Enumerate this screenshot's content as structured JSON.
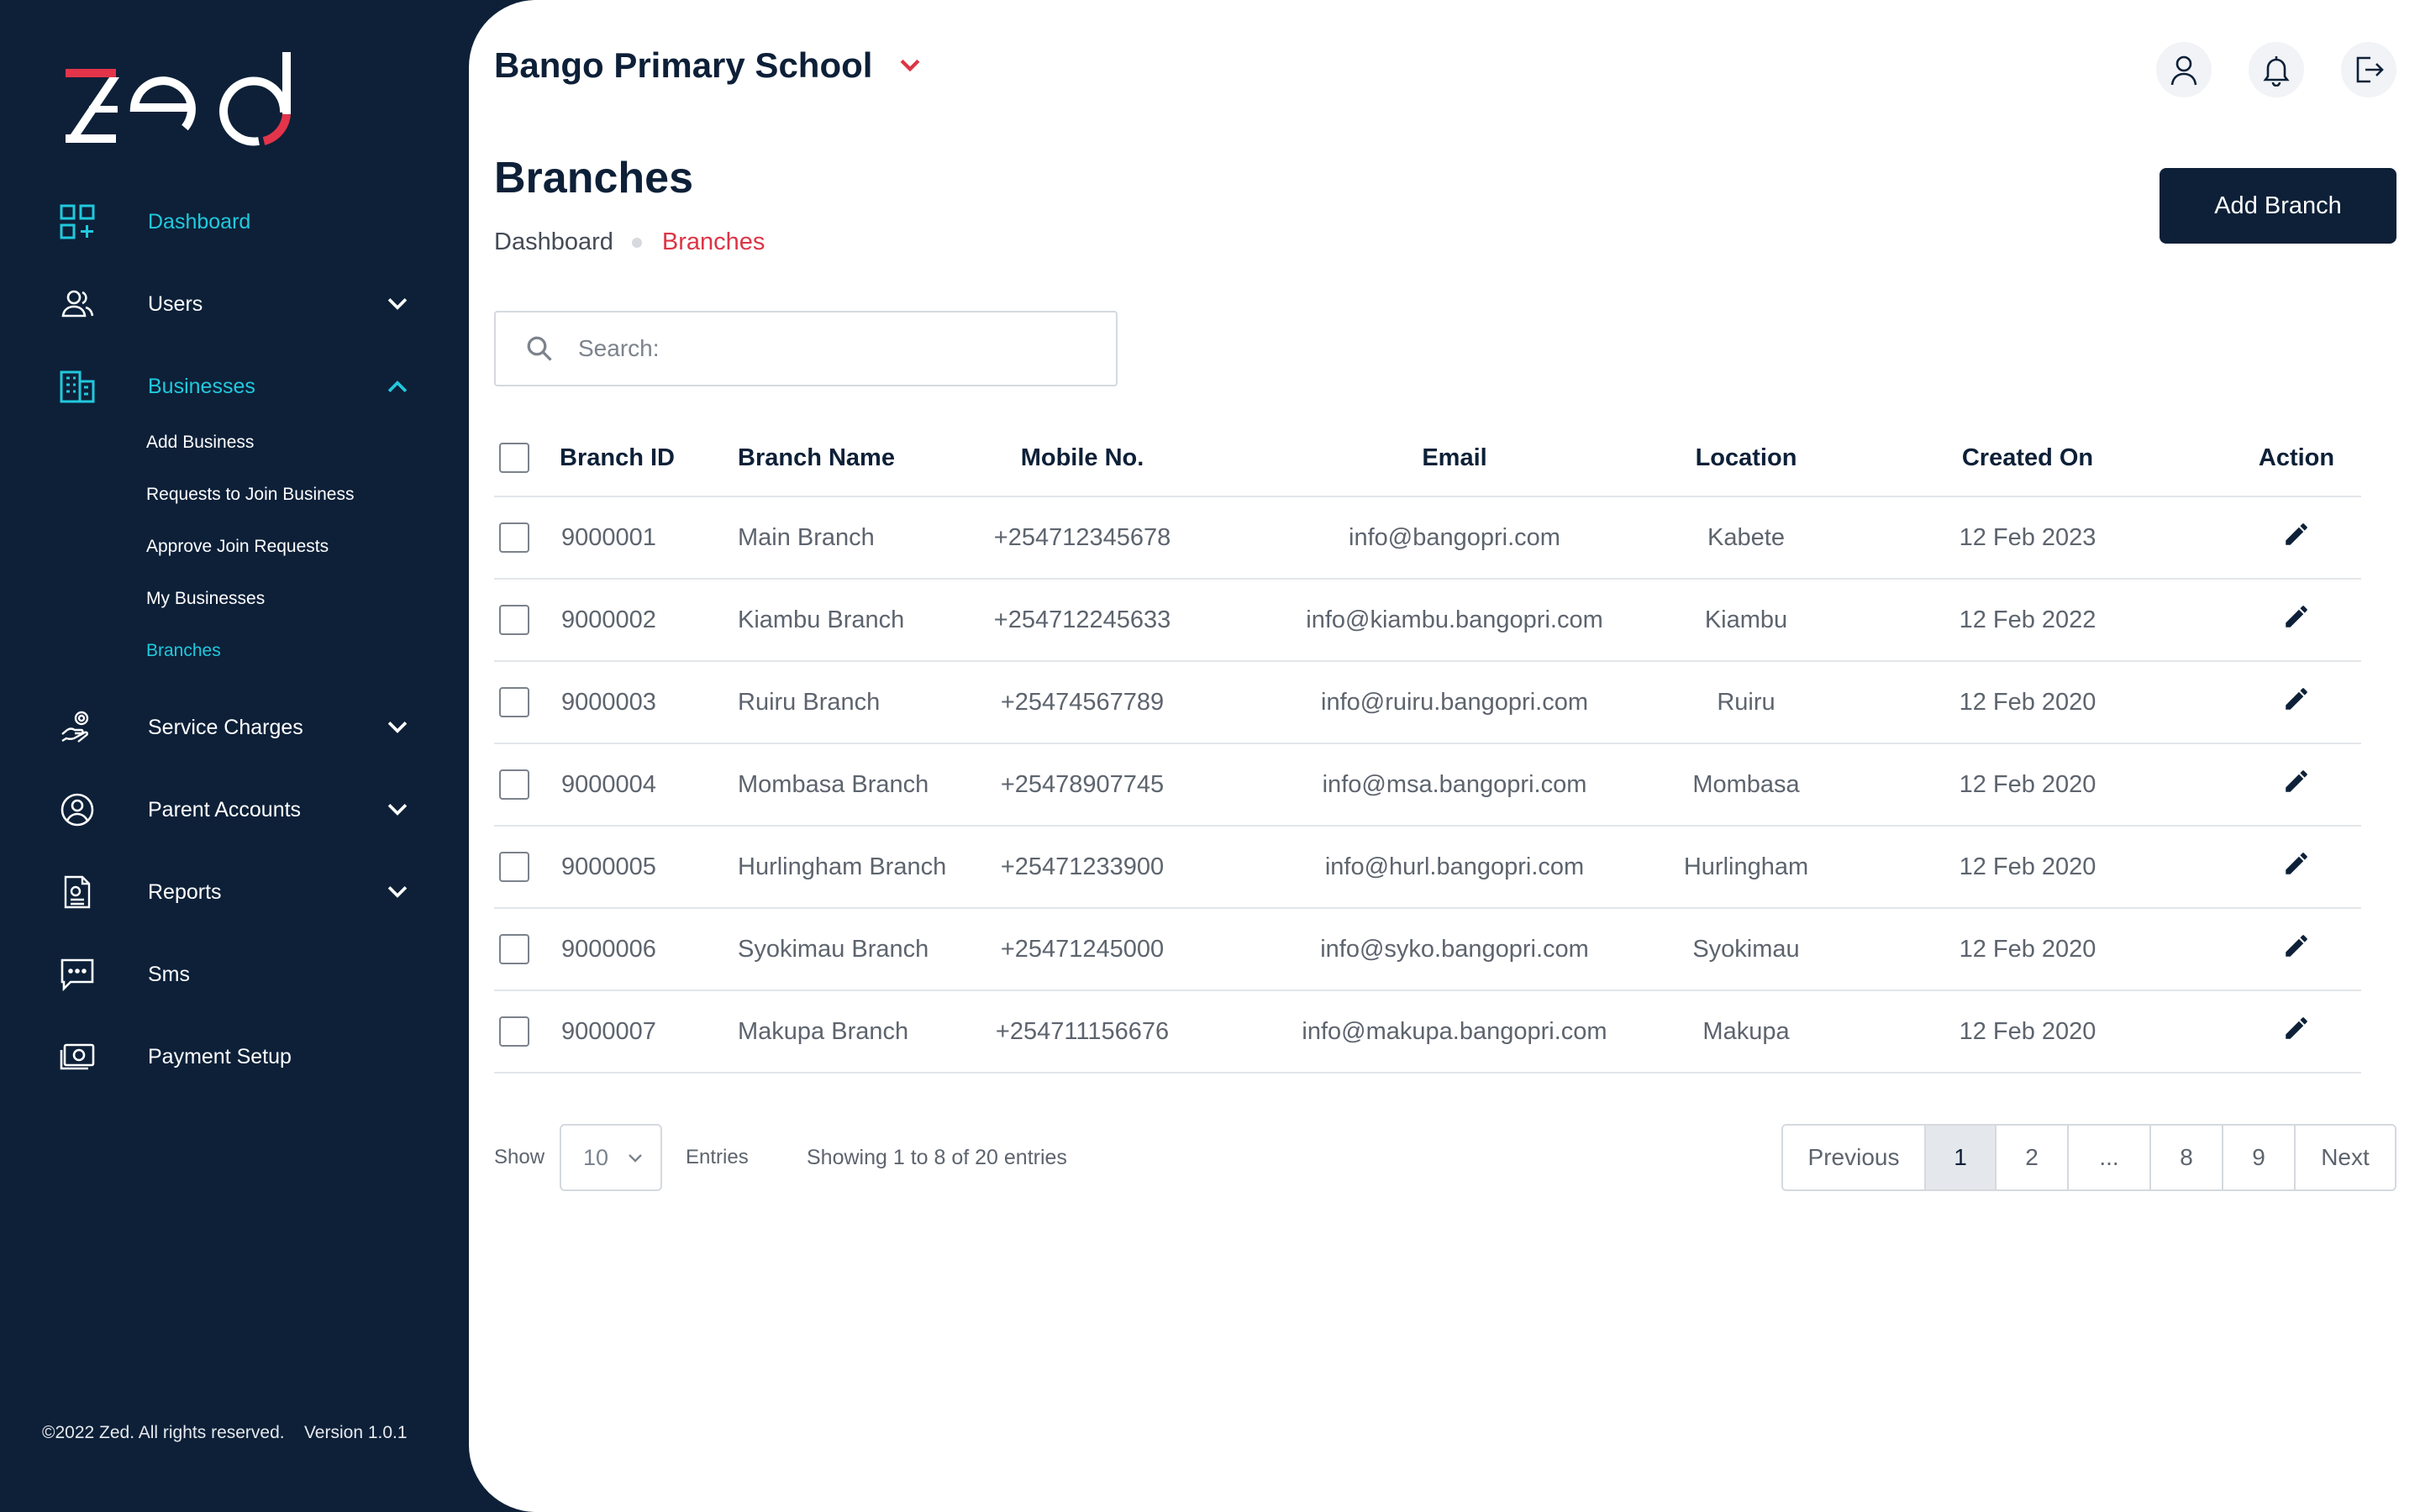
{
  "brand": {
    "logo_text": "zed",
    "colors": {
      "navy": "#0d2038",
      "cyan": "#21c9dd",
      "red": "#dc3545",
      "logo_red": "#e3344a"
    }
  },
  "sidebar": {
    "items": [
      {
        "label": "Dashboard",
        "icon": "dashboard-grid-icon",
        "active": true
      },
      {
        "label": "Users",
        "icon": "users-icon",
        "expandable": true
      },
      {
        "label": "Businesses",
        "icon": "business-building-icon",
        "active": true,
        "expanded": true
      },
      {
        "label": "Service Charges",
        "icon": "hand-coin-icon",
        "expandable": true
      },
      {
        "label": "Parent Accounts",
        "icon": "user-circle-icon",
        "expandable": true
      },
      {
        "label": "Reports",
        "icon": "report-document-icon",
        "expandable": true
      },
      {
        "label": "Sms",
        "icon": "chat-bubble-icon"
      },
      {
        "label": "Payment Setup",
        "icon": "cash-icon"
      }
    ],
    "business_sub_items": [
      {
        "label": "Add Business"
      },
      {
        "label": "Requests to Join Business"
      },
      {
        "label": "Approve Join Requests"
      },
      {
        "label": "My Businesses"
      },
      {
        "label": "Branches",
        "active": true
      }
    ],
    "footer": "©2022 Zed. All rights reserved.    Version 1.0.1"
  },
  "header": {
    "school_name": "Bango Primary School",
    "icons": [
      "user-icon",
      "bell-icon",
      "logout-icon"
    ]
  },
  "page": {
    "title": "Branches",
    "breadcrumb": [
      "Dashboard",
      "Branches"
    ],
    "add_button": "Add Branch",
    "search_placeholder": "Search:"
  },
  "table": {
    "columns": [
      "Branch ID",
      "Branch Name",
      "Mobile No.",
      "Email",
      "Location",
      "Created On",
      "Action"
    ],
    "rows": [
      {
        "id": "9000001",
        "name": "Main Branch",
        "mobile": "+254712345678",
        "email": "info@bangopri.com",
        "location": "Kabete",
        "created": "12 Feb 2023"
      },
      {
        "id": "9000002",
        "name": "Kiambu Branch",
        "mobile": "+254712245633",
        "email": "info@kiambu.bangopri.com",
        "location": "Kiambu",
        "created": "12 Feb 2022"
      },
      {
        "id": "9000003",
        "name": "Ruiru Branch",
        "mobile": "+25474567789",
        "email": "info@ruiru.bangopri.com",
        "location": "Ruiru",
        "created": "12 Feb 2020"
      },
      {
        "id": "9000004",
        "name": "Mombasa Branch",
        "mobile": "+25478907745",
        "email": "info@msa.bangopri.com",
        "location": "Mombasa",
        "created": "12 Feb 2020"
      },
      {
        "id": "9000005",
        "name": "Hurlingham Branch",
        "mobile": "+25471233900",
        "email": "info@hurl.bangopri.com",
        "location": "Hurlingham",
        "created": "12 Feb 2020"
      },
      {
        "id": "9000006",
        "name": "Syokimau Branch",
        "mobile": "+25471245000",
        "email": "info@syko.bangopri.com",
        "location": "Syokimau",
        "created": "12 Feb 2020"
      },
      {
        "id": "9000007",
        "name": "Makupa Branch",
        "mobile": "+254711156676",
        "email": "info@makupa.bangopri.com",
        "location": "Makupa",
        "created": "12 Feb 2020"
      }
    ]
  },
  "footer_controls": {
    "show_label": "Show",
    "entries_value": "10",
    "entries_label": "Entries",
    "showing_text": "Showing 1 to 8 of 20 entries"
  },
  "pagination": {
    "previous": "Previous",
    "pages": [
      "1",
      "2",
      "...",
      "8",
      "9"
    ],
    "active_page": "1",
    "next": "Next"
  }
}
